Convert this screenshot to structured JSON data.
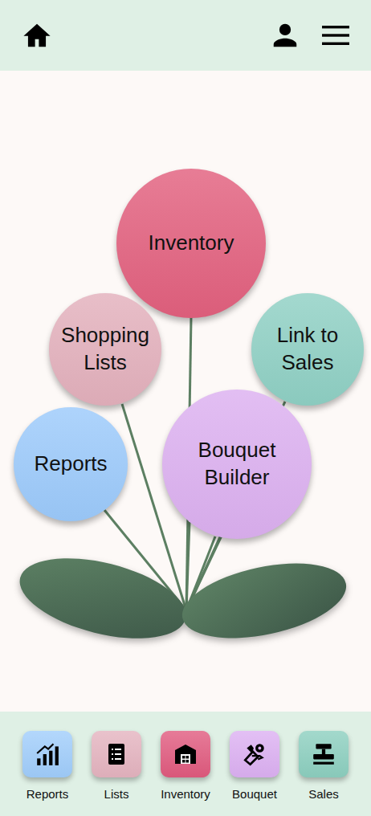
{
  "flower": {
    "nodes": [
      {
        "label": "Inventory",
        "color": "#e2607e"
      },
      {
        "label": "Shopping Lists",
        "color": "#e3b0bc"
      },
      {
        "label": "Link to Sales",
        "color": "#8fd0c4"
      },
      {
        "label": "Reports",
        "color": "#9ccafb"
      },
      {
        "label": "Bouquet Builder",
        "color": "#dcb0f0"
      }
    ]
  },
  "bottom_nav": {
    "items": [
      {
        "label": "Reports",
        "color": "#a0cdfb"
      },
      {
        "label": "Lists",
        "color": "#e4b3bf"
      },
      {
        "label": "Inventory",
        "color": "#e05a7e"
      },
      {
        "label": "Bouquet",
        "color": "#dcb0f2"
      },
      {
        "label": "Sales",
        "color": "#8ccfbf"
      }
    ]
  }
}
